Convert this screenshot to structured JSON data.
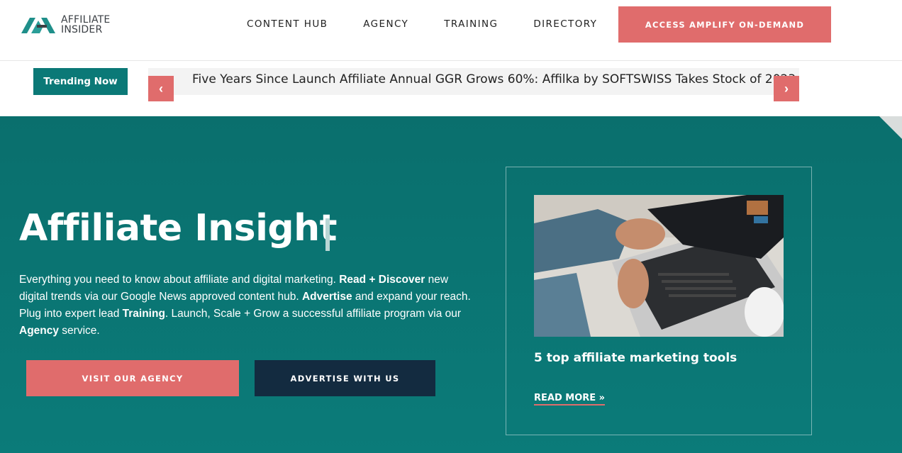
{
  "header": {
    "logo_line1": "AFFILIATE",
    "logo_line2": "INSIDER",
    "nav": [
      "CONTENT HUB",
      "AGENCY",
      "TRAINING",
      "DIRECTORY"
    ],
    "cta": "ACCESS AMPLIFY ON-DEMAND"
  },
  "ticker": {
    "badge": "Trending Now",
    "headline": "Five Years Since Launch Affiliate Annual GGR Grows 60%: Affilka by SOFTSWISS Takes Stock of 2023",
    "prev_icon": "chevron-left-icon",
    "next_icon": "chevron-right-icon"
  },
  "hero": {
    "title": "Affiliate Insight",
    "desc_1": "Everything you need to know about affiliate and digital marketing. ",
    "desc_b1": "Read + Discover",
    "desc_2": " new digital trends via our Google News approved content hub. ",
    "desc_b2": "Advertise",
    "desc_3": " and expand your reach. Plug into expert lead ",
    "desc_b3": "Training",
    "desc_4": ". Launch, Scale + Grow a successful affiliate program via our ",
    "desc_b4": "Agency",
    "desc_5": " service.",
    "btn_agency": "VISIT OUR AGENCY",
    "btn_advertise": "ADVERTISE WITH US"
  },
  "card": {
    "title": "5 top affiliate marketing tools",
    "read_more": "READ MORE »"
  },
  "colors": {
    "teal": "#0b7977",
    "coral": "#e06c6c",
    "navy": "#132b40"
  }
}
